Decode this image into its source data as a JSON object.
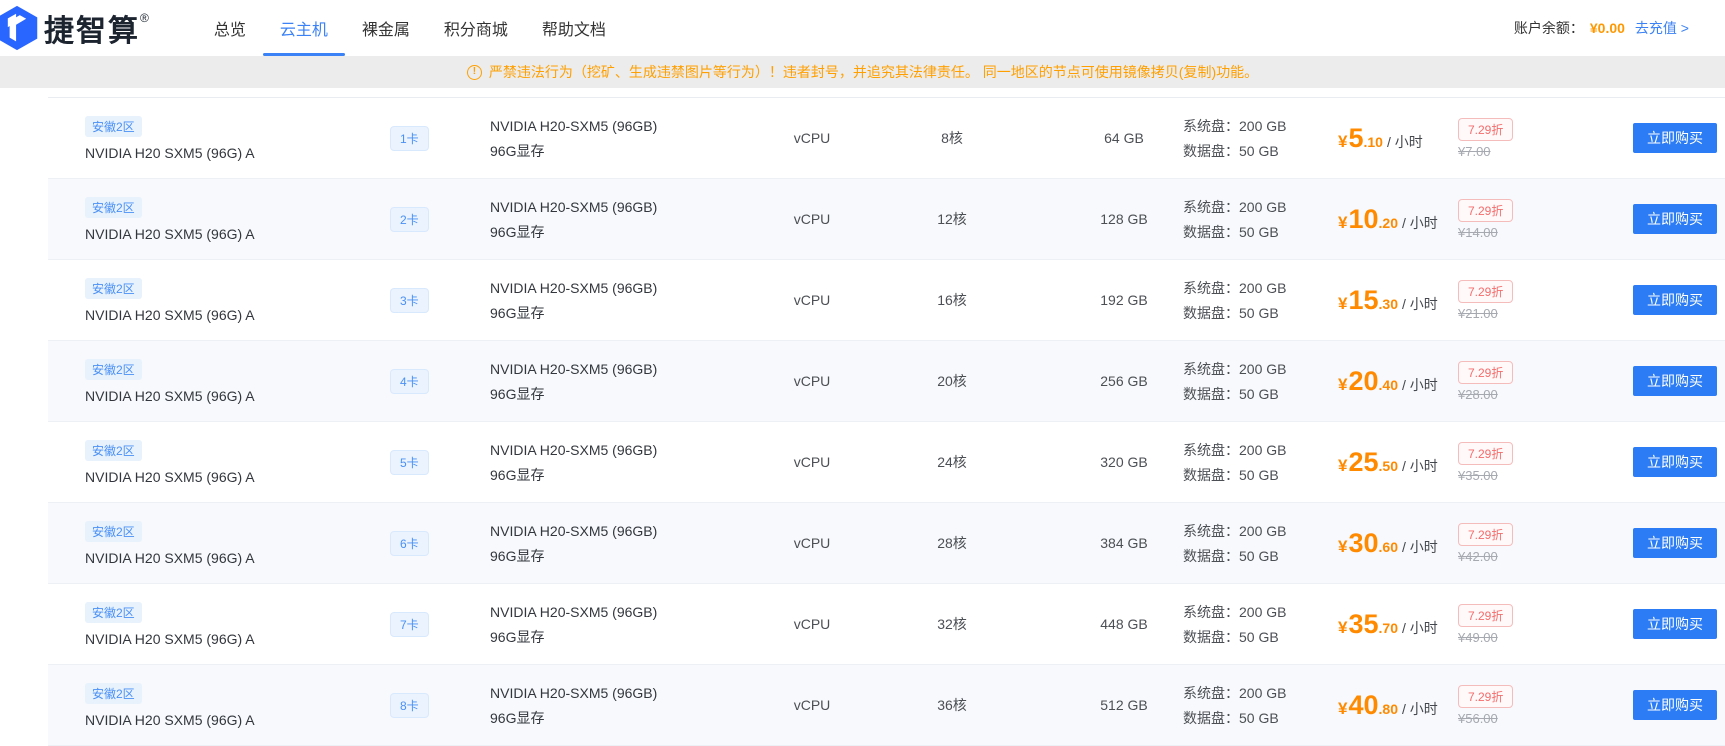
{
  "header": {
    "logo": {
      "text": "捷智算",
      "reg": "®"
    },
    "nav": [
      {
        "label": "总览",
        "active": false
      },
      {
        "label": "云主机",
        "active": true
      },
      {
        "label": "裸金属",
        "active": false
      },
      {
        "label": "积分商城",
        "active": false
      },
      {
        "label": "帮助文档",
        "active": false
      }
    ],
    "account": {
      "balance_label": "账户余额：",
      "balance_value": "¥0.00",
      "recharge_label": "去充值 >"
    }
  },
  "banner": {
    "icon": "!",
    "text": "严禁违法行为（挖矿、生成违禁图片等行为）！违者封号，并追究其法律责任。 同一地区的节点可使用镜像拷贝(复制)功能。"
  },
  "labels": {
    "cpu_type": "vCPU",
    "currency": "¥",
    "price_unit": "/ 小时",
    "sys_disk_label": "系统盘：",
    "data_disk_label": "数据盘：",
    "buy_label": "立即购买"
  },
  "table": {
    "rows": [
      {
        "region": "安徽2区",
        "name": "NVIDIA H20 SXM5 (96G) A",
        "cards": "1卡",
        "gpu_model": "NVIDIA H20-SXM5 (96GB)",
        "gpu_mem": "96G显存",
        "cores": "8核",
        "ram": "64 GB",
        "sys_disk": "200 GB",
        "data_disk": "50 GB",
        "price_int": "5",
        "price_dec": ".10",
        "discount": "7.29折",
        "orig_price": "¥7.00"
      },
      {
        "region": "安徽2区",
        "name": "NVIDIA H20 SXM5 (96G) A",
        "cards": "2卡",
        "gpu_model": "NVIDIA H20-SXM5 (96GB)",
        "gpu_mem": "96G显存",
        "cores": "12核",
        "ram": "128 GB",
        "sys_disk": "200 GB",
        "data_disk": "50 GB",
        "price_int": "10",
        "price_dec": ".20",
        "discount": "7.29折",
        "orig_price": "¥14.00"
      },
      {
        "region": "安徽2区",
        "name": "NVIDIA H20 SXM5 (96G) A",
        "cards": "3卡",
        "gpu_model": "NVIDIA H20-SXM5 (96GB)",
        "gpu_mem": "96G显存",
        "cores": "16核",
        "ram": "192 GB",
        "sys_disk": "200 GB",
        "data_disk": "50 GB",
        "price_int": "15",
        "price_dec": ".30",
        "discount": "7.29折",
        "orig_price": "¥21.00"
      },
      {
        "region": "安徽2区",
        "name": "NVIDIA H20 SXM5 (96G) A",
        "cards": "4卡",
        "gpu_model": "NVIDIA H20-SXM5 (96GB)",
        "gpu_mem": "96G显存",
        "cores": "20核",
        "ram": "256 GB",
        "sys_disk": "200 GB",
        "data_disk": "50 GB",
        "price_int": "20",
        "price_dec": ".40",
        "discount": "7.29折",
        "orig_price": "¥28.00"
      },
      {
        "region": "安徽2区",
        "name": "NVIDIA H20 SXM5 (96G) A",
        "cards": "5卡",
        "gpu_model": "NVIDIA H20-SXM5 (96GB)",
        "gpu_mem": "96G显存",
        "cores": "24核",
        "ram": "320 GB",
        "sys_disk": "200 GB",
        "data_disk": "50 GB",
        "price_int": "25",
        "price_dec": ".50",
        "discount": "7.29折",
        "orig_price": "¥35.00"
      },
      {
        "region": "安徽2区",
        "name": "NVIDIA H20 SXM5 (96G) A",
        "cards": "6卡",
        "gpu_model": "NVIDIA H20-SXM5 (96GB)",
        "gpu_mem": "96G显存",
        "cores": "28核",
        "ram": "384 GB",
        "sys_disk": "200 GB",
        "data_disk": "50 GB",
        "price_int": "30",
        "price_dec": ".60",
        "discount": "7.29折",
        "orig_price": "¥42.00"
      },
      {
        "region": "安徽2区",
        "name": "NVIDIA H20 SXM5 (96G) A",
        "cards": "7卡",
        "gpu_model": "NVIDIA H20-SXM5 (96GB)",
        "gpu_mem": "96G显存",
        "cores": "32核",
        "ram": "448 GB",
        "sys_disk": "200 GB",
        "data_disk": "50 GB",
        "price_int": "35",
        "price_dec": ".70",
        "discount": "7.29折",
        "orig_price": "¥49.00"
      },
      {
        "region": "安徽2区",
        "name": "NVIDIA H20 SXM5 (96G) A",
        "cards": "8卡",
        "gpu_model": "NVIDIA H20-SXM5 (96GB)",
        "gpu_mem": "96G显存",
        "cores": "36核",
        "ram": "512 GB",
        "sys_disk": "200 GB",
        "data_disk": "50 GB",
        "price_int": "40",
        "price_dec": ".80",
        "discount": "7.29折",
        "orig_price": "¥56.00"
      }
    ]
  },
  "colors": {
    "accent_blue": "#2b7cf5",
    "active_tab_blue": "#3b82f6",
    "price_orange": "#ff8a00",
    "balance_orange": "#ff9800",
    "warning_orange": "#ffa000",
    "discount_red": "#f56c6c",
    "row_alt_bg": "#f7f9fc",
    "badge_blue_bg": "#e8f2fd",
    "badge_blue_text": "#4a90f5"
  }
}
